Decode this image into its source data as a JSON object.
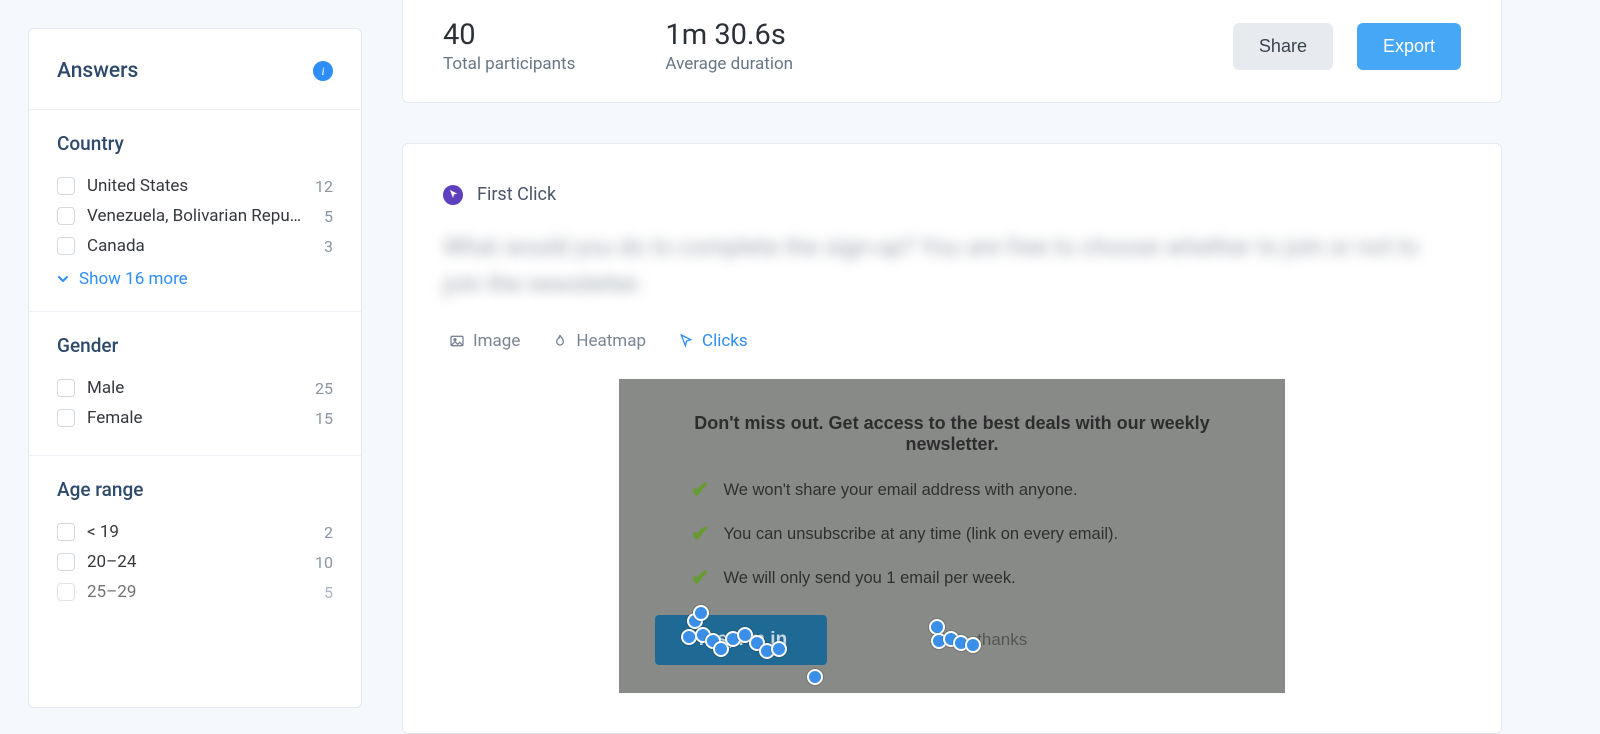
{
  "sidebar": {
    "title": "Answers",
    "groups": [
      {
        "key": "country",
        "title": "Country",
        "items": [
          {
            "label": "United States",
            "count": 12
          },
          {
            "label": "Venezuela, Bolivarian Repu…",
            "count": 5
          },
          {
            "label": "Canada",
            "count": 3
          }
        ],
        "show_more": "Show 16 more"
      },
      {
        "key": "gender",
        "title": "Gender",
        "items": [
          {
            "label": "Male",
            "count": 25
          },
          {
            "label": "Female",
            "count": 15
          }
        ]
      },
      {
        "key": "age",
        "title": "Age range",
        "items": [
          {
            "label": "< 19",
            "count": 2
          },
          {
            "label": "20–24",
            "count": 10
          },
          {
            "label": "25–29",
            "count": 5
          }
        ]
      }
    ]
  },
  "stats": {
    "participants_value": "40",
    "participants_label": "Total participants",
    "duration_value": "1m 30.6s",
    "duration_label": "Average duration",
    "share_label": "Share",
    "export_label": "Export"
  },
  "first_click": {
    "badge_label": "First Click",
    "question": "What would you do to complete the sign-up? You are free to choose whether to join or not to join the newsletter.",
    "tabs": {
      "image": "Image",
      "heatmap": "Heatmap",
      "clicks": "Clicks"
    },
    "active_tab": "clicks",
    "capture": {
      "headline": "Don't miss out. Get access to the best deals with our weekly newsletter.",
      "bullets": [
        "We won't share your email address with anyone.",
        "You can unsubscribe at any time (link on every email).",
        "We will only send you 1 email per week."
      ],
      "primary_button": "Yes, I'm in",
      "secondary_link": "thanks"
    }
  }
}
